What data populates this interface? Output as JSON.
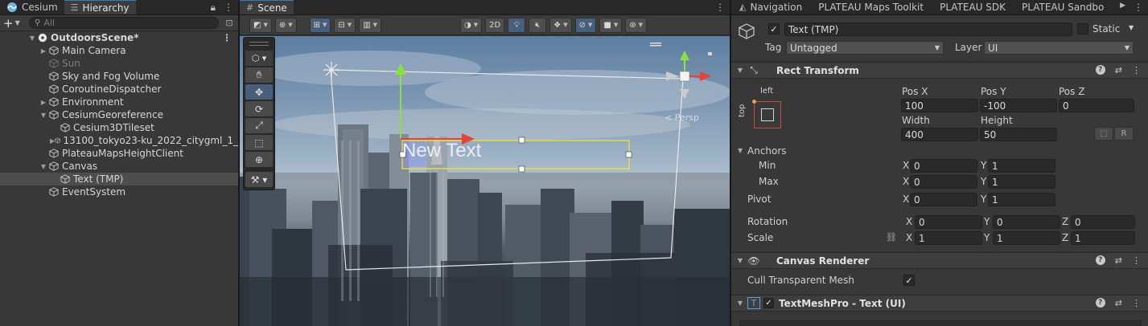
{
  "hierarchy": {
    "tabs": [
      {
        "label": "Cesium",
        "icon": "cesium-icon"
      },
      {
        "label": "Hierarchy",
        "icon": "hierarchy-icon"
      }
    ],
    "search_placeholder": "All",
    "scene_name": "OutdoorsScene*",
    "items": [
      {
        "label": "Main Camera",
        "depth": 1,
        "arrow": "right",
        "dim": false
      },
      {
        "label": "Sun",
        "depth": 1,
        "arrow": "",
        "dim": true
      },
      {
        "label": "Sky and Fog Volume",
        "depth": 1,
        "arrow": "",
        "dim": false
      },
      {
        "label": "CoroutineDispatcher",
        "depth": 1,
        "arrow": "",
        "dim": false
      },
      {
        "label": "Environment",
        "depth": 1,
        "arrow": "right",
        "dim": false
      },
      {
        "label": "CesiumGeoreference",
        "depth": 1,
        "arrow": "down",
        "dim": false
      },
      {
        "label": "Cesium3DTileset",
        "depth": 2,
        "arrow": "",
        "dim": false
      },
      {
        "label": "13100_tokyo23-ku_2022_citygml_1_",
        "depth": 2,
        "arrow": "right",
        "dim": false
      },
      {
        "label": "PlateauMapsHeightClient",
        "depth": 1,
        "arrow": "",
        "dim": false
      },
      {
        "label": "Canvas",
        "depth": 1,
        "arrow": "down",
        "dim": false
      },
      {
        "label": "Text (TMP)",
        "depth": 2,
        "arrow": "",
        "dim": false,
        "selected": true
      },
      {
        "label": "EventSystem",
        "depth": 1,
        "arrow": "",
        "dim": false
      }
    ]
  },
  "scene": {
    "tab_label": "Scene",
    "toolbar_2d": "2D",
    "ui_text": "New Text",
    "persp_label": "< Persp"
  },
  "inspector": {
    "tabs": [
      "Navigation",
      "PLATEAU Maps Toolkit",
      "PLATEAU SDK",
      "PLATEAU Sandbo"
    ],
    "object_name": "Text (TMP)",
    "static_label": "Static",
    "tag_label": "Tag",
    "tag_value": "Untagged",
    "layer_label": "Layer",
    "layer_value": "UI",
    "rect_transform": {
      "title": "Rect Transform",
      "anchor_h": "left",
      "anchor_v": "top",
      "pos_x_label": "Pos X",
      "pos_x": "100",
      "pos_y_label": "Pos Y",
      "pos_y": "-100",
      "pos_z_label": "Pos Z",
      "pos_z": "0",
      "width_label": "Width",
      "width": "400",
      "height_label": "Height",
      "height": "50",
      "r_button": "R",
      "anchors_label": "Anchors",
      "min_label": "Min",
      "min_x": "0",
      "min_y": "1",
      "max_label": "Max",
      "max_x": "0",
      "max_y": "1",
      "pivot_label": "Pivot",
      "pivot_x": "0",
      "pivot_y": "1",
      "rotation_label": "Rotation",
      "rot_x": "0",
      "rot_y": "0",
      "rot_z": "0",
      "scale_label": "Scale",
      "scale_x": "1",
      "scale_y": "1",
      "scale_z": "1",
      "axis_x": "X",
      "axis_y": "Y",
      "axis_z": "Z"
    },
    "canvas_renderer": {
      "title": "Canvas Renderer",
      "cull_label": "Cull Transparent Mesh"
    },
    "textmeshpro": {
      "title": "TextMeshPro - Text (UI)"
    }
  },
  "colors": {
    "selection": "#4d4d4d",
    "accent_blue": "#3a79bb",
    "gizmo_x": "#e8403a",
    "gizmo_y": "#8be03b",
    "rect_outline": "#e6e23a"
  }
}
